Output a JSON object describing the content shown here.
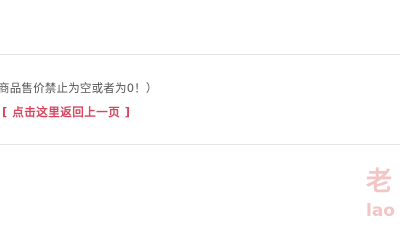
{
  "message": {
    "text": "商品售价禁止为空或者为0！）"
  },
  "back_link": {
    "label": "[ 点击这里返回上一页 ]"
  },
  "watermark": {
    "line1": "老",
    "line2": "lao"
  },
  "colors": {
    "link": "#d9455f",
    "text": "#555555",
    "divider": "#e6e6e6",
    "watermark": "#f3c5c5"
  }
}
